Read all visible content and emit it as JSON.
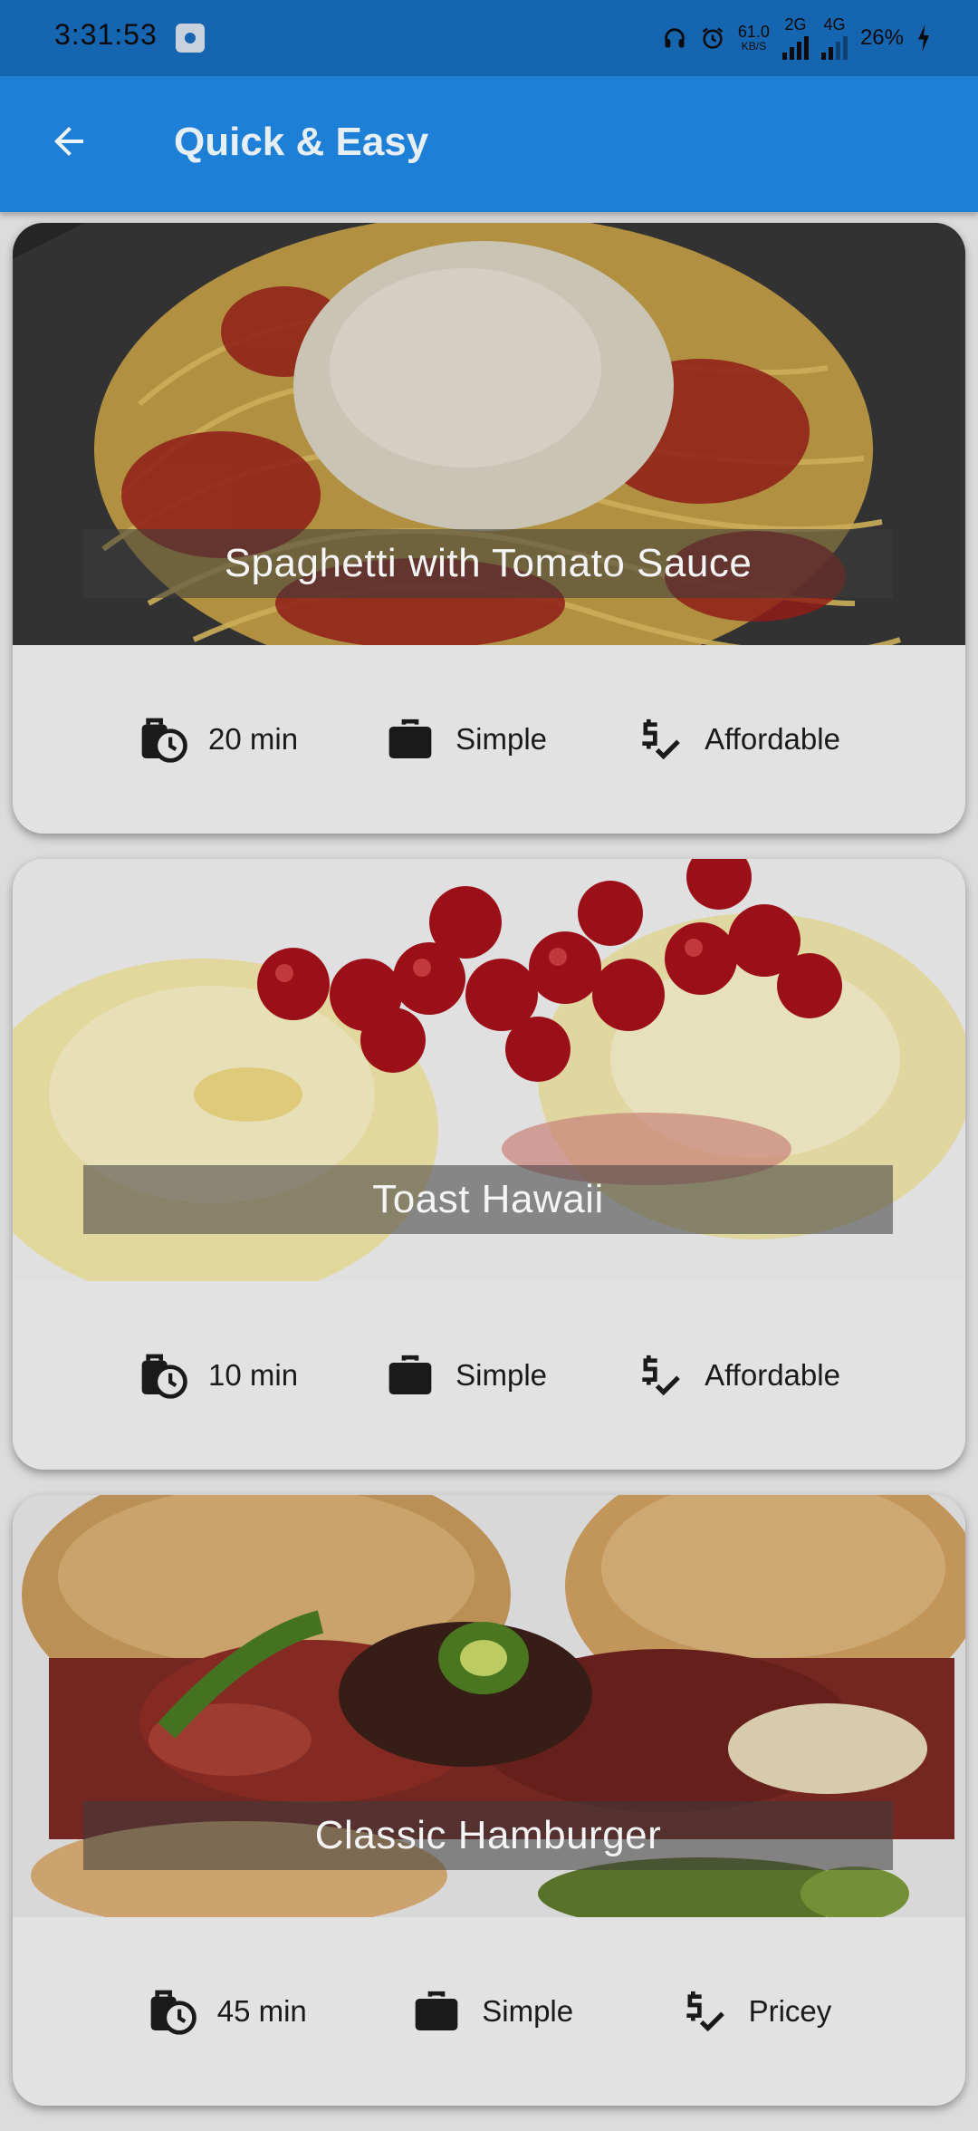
{
  "status_bar": {
    "time": "3:31:53",
    "speed_value": "61.0",
    "speed_unit": "KB/S",
    "network_2g": "2G",
    "network_4g": "4G",
    "battery": "26%",
    "icons": [
      "settings-icon",
      "headphones-icon",
      "alarm-icon",
      "signal-icon",
      "battery-charging-icon"
    ]
  },
  "app_bar": {
    "title": "Quick & Easy",
    "back_icon": "arrow-back-icon"
  },
  "meals": [
    {
      "title": "Spaghetti with Tomato Sauce",
      "duration": "20 min",
      "complexity": "Simple",
      "affordability": "Affordable"
    },
    {
      "title": "Toast Hawaii",
      "duration": "10 min",
      "complexity": "Simple",
      "affordability": "Affordable"
    },
    {
      "title": "Classic Hamburger",
      "duration": "45 min",
      "complexity": "Simple",
      "affordability": "Pricey"
    }
  ],
  "colors": {
    "status_bar": "#1565b0",
    "app_bar": "#1e7fd6",
    "background": "#dcdcdc",
    "card": "#e2e2e2"
  }
}
